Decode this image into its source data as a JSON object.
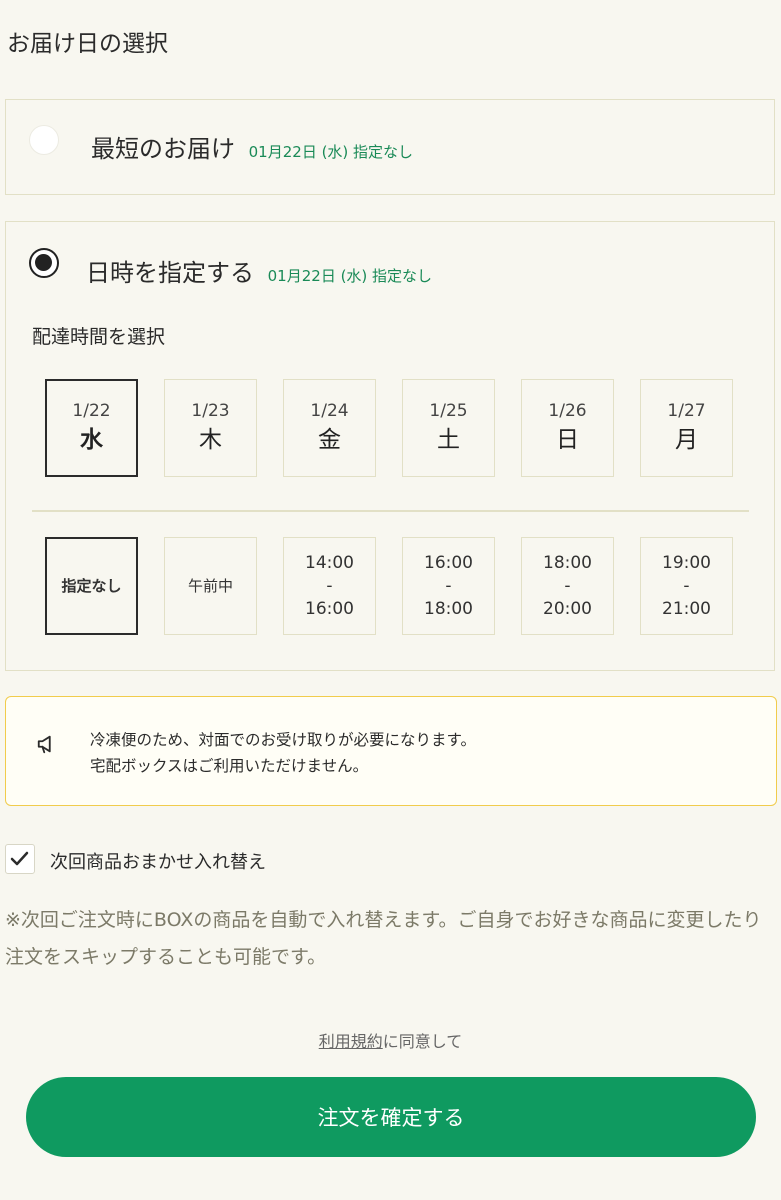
{
  "page_title": "お届け日の選択",
  "option_fastest": {
    "label": "最短のお届け",
    "sub": "01月22日 (水) 指定なし"
  },
  "option_specify": {
    "label": "日時を指定する",
    "sub": "01月22日 (水) 指定なし"
  },
  "section_label": "配達時間を選択",
  "dates": [
    {
      "date": "1/22",
      "weekday": "水"
    },
    {
      "date": "1/23",
      "weekday": "木"
    },
    {
      "date": "1/24",
      "weekday": "金"
    },
    {
      "date": "1/25",
      "weekday": "土"
    },
    {
      "date": "1/26",
      "weekday": "日"
    },
    {
      "date": "1/27",
      "weekday": "月"
    }
  ],
  "times": [
    {
      "lines": [
        "指定なし"
      ]
    },
    {
      "lines": [
        "午前中"
      ]
    },
    {
      "lines": [
        "14:00",
        "-",
        "16:00"
      ]
    },
    {
      "lines": [
        "16:00",
        "-",
        "18:00"
      ]
    },
    {
      "lines": [
        "18:00",
        "-",
        "20:00"
      ]
    },
    {
      "lines": [
        "19:00",
        "-",
        "21:00"
      ]
    }
  ],
  "notice": {
    "line1": "冷凍便のため、対面でのお受け取りが必要になります。",
    "line2": "宅配ボックスはご利用いただけません。"
  },
  "checkbox_label": "次回商品おまかせ入れ替え",
  "note": "※次回ご注文時にBOXの商品を自動で入れ替えます。ご自身でお好きな商品に変更したり注文をスキップすることも可能です。",
  "terms_link": "利用規約",
  "terms_suffix": "に同意して",
  "cta_label": "注文を確定する",
  "colors": {
    "accent": "#0f9a60",
    "sub_text": "#1a8a57",
    "notice_border": "#f1cc4c"
  }
}
